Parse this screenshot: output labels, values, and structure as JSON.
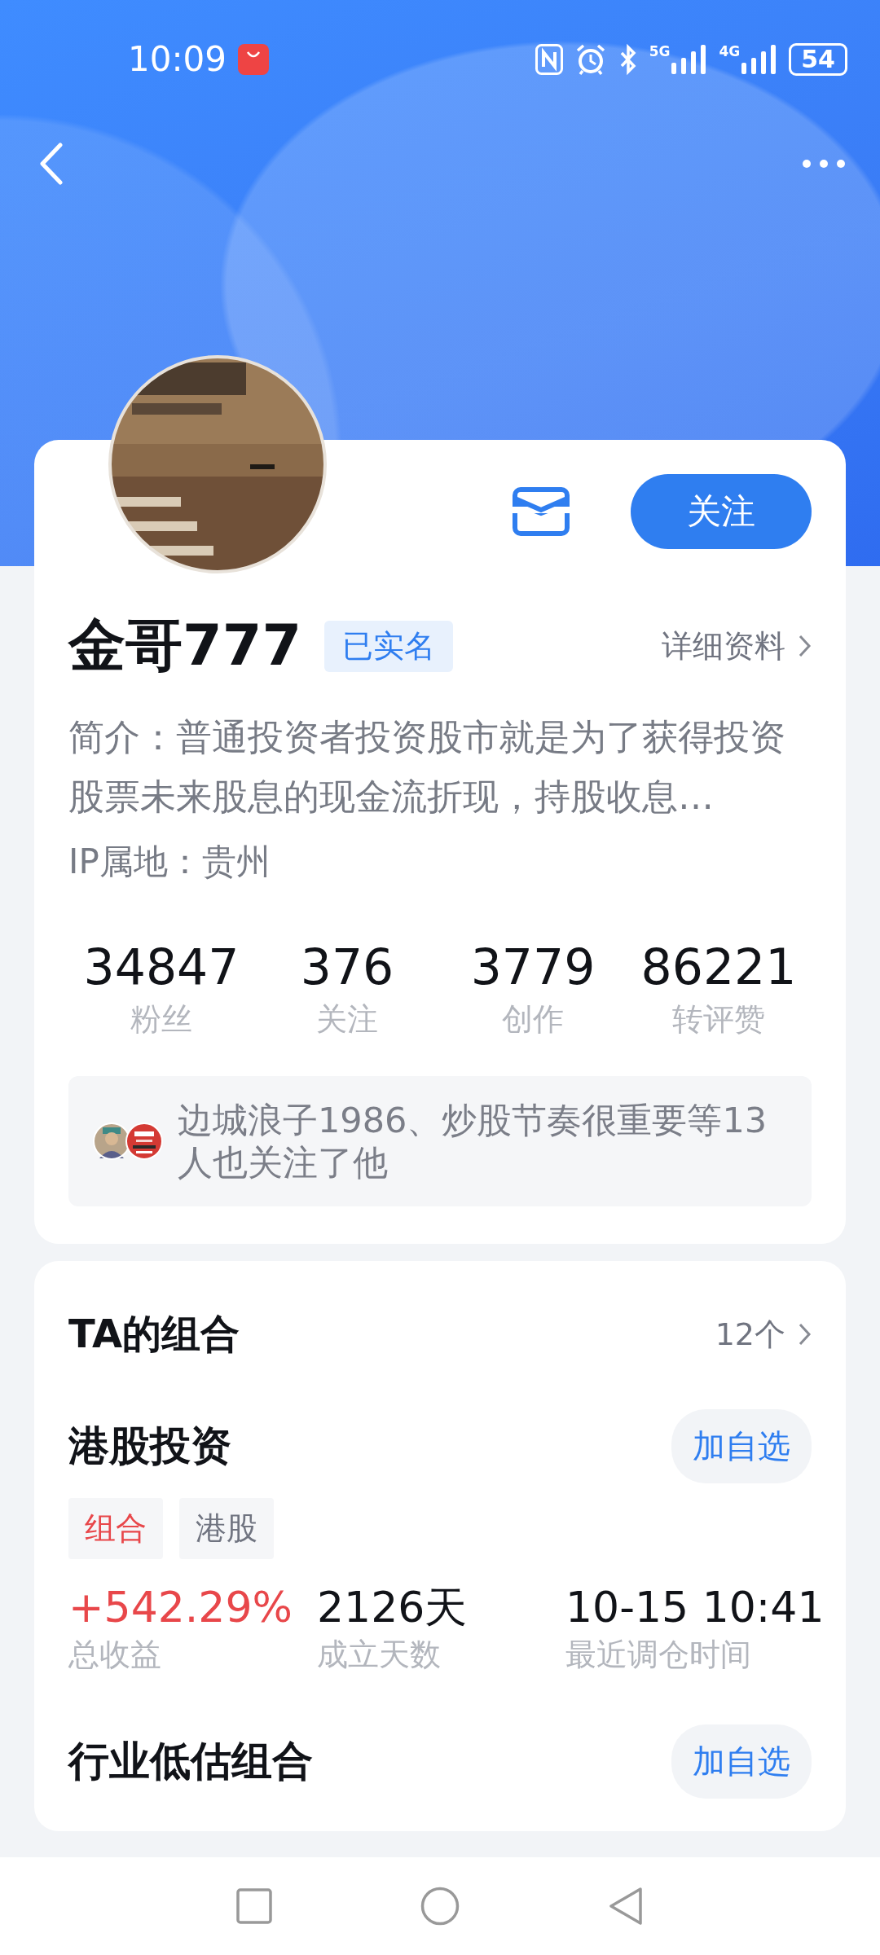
{
  "status_bar": {
    "time": "10:09",
    "network_1": "5G",
    "network_2": "4G",
    "battery": "54"
  },
  "profile": {
    "follow_button": "关注",
    "name": "金哥777",
    "badge": "已实名",
    "details_link": "详细资料",
    "intro": "简介：普通投资者投资股市就是为了获得投资股票未来股息的现金流折现，持股收息…",
    "ip_location": "IP属地：贵州",
    "stats": [
      {
        "value": "34847",
        "label": "粉丝"
      },
      {
        "value": "376",
        "label": "关注"
      },
      {
        "value": "3779",
        "label": "创作"
      },
      {
        "value": "86221",
        "label": "转评赞"
      }
    ],
    "mutual_followers": "边城浪子1986、炒股节奏很重要等13人也关注了他"
  },
  "portfolios": {
    "title": "TA的组合",
    "count": "12个",
    "items": [
      {
        "name": "港股投资",
        "button": "加自选",
        "tags": [
          {
            "label": "组合",
            "kind": "type"
          },
          {
            "label": "港股",
            "kind": "market"
          }
        ],
        "metrics": [
          {
            "value": "+542.29%",
            "label": "总收益",
            "kind": "return"
          },
          {
            "value": "2126天",
            "label": "成立天数",
            "kind": "plain"
          },
          {
            "value": "10-15 10:41",
            "label": "最近调仓时间",
            "kind": "plain"
          }
        ]
      },
      {
        "name": "行业低估组合",
        "button": "加自选"
      }
    ]
  }
}
